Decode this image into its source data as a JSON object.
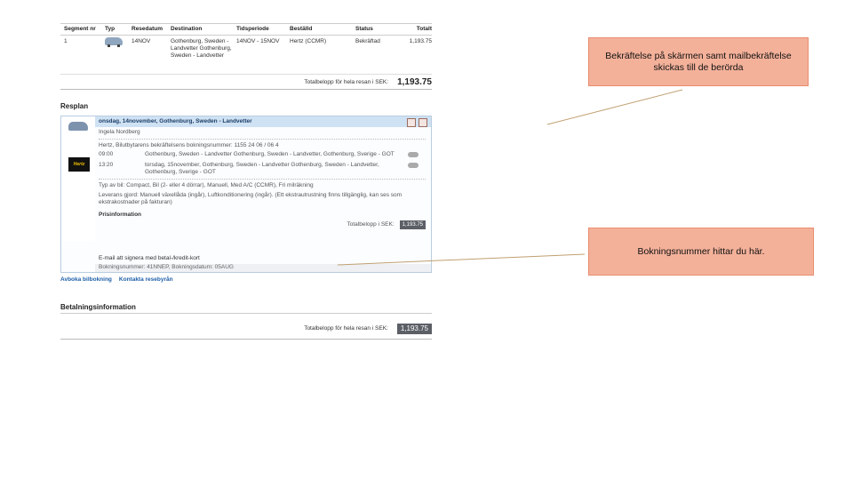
{
  "summary": {
    "headers": [
      "Segment nr",
      "Typ",
      "Resedatum",
      "Destination",
      "Tidsperiode",
      "Beställd",
      "Status",
      "Totalt"
    ],
    "row": {
      "segment": "1",
      "date": "14NOV",
      "destination": "Gothenburg, Sweden - Landvetter Gothenburg, Sweden - Landvetter",
      "period": "14NOV - 15NOV",
      "ordered": "Hertz (CCMR)",
      "status": "Bekräftad",
      "total": "1,193.75"
    },
    "total_label": "Totalbelopp för hela resan i SEK:",
    "total_amount": "1,193.75"
  },
  "itinerary": {
    "title": "Resplan",
    "header": "onsdag, 14november, Gothenburg, Sweden - Landvetter",
    "traveller": "Ingela Nordberg",
    "confirmation": "Hertz, Bilutbytarens bekräftelsens bokningsnummer: 1155 24 06 / 06 4",
    "logo": "Hertz",
    "legs": [
      {
        "time": "09:00",
        "text": "Gothenburg, Sweden - Landvetter Gothenburg, Sweden - Landvetter, Gothenburg, Sverige - GOT"
      },
      {
        "time": "13:20",
        "text": "torsdag, 15november, Gothenburg, Sweden - Landvetter Gothenburg, Sweden - Landvetter, Gothenburg, Sverige - GOT"
      }
    ],
    "car_info": "Typ av bil: Compact, Bil (2- eller 4 dörrar), Manuell, Med A/C (CCMR), Fri milräkning",
    "conditions": "Leverans gjord: Manuell växellåda (ingår), Luftkonditionering (ingår). (Ett ekstrautrustning finns tillgänglig, kan ses som ekstrakostnader på fakturan)",
    "price_heading": "Prisinformation",
    "price_label": "Totalbelopp i SEK:",
    "price_value": "1,193.75",
    "email_note": "E-mail att signera med betal-/kredit-kort",
    "booking_ref": "Bokningsnummer: 41NNEP, Bokningsdatum: 05AUG"
  },
  "links": {
    "cancel": "Avboka bilbokning",
    "contact": "Kontakta resebyrån"
  },
  "payment": {
    "title": "Betalningsinformation",
    "total_label": "Totalbelopp för hela resan i SEK:",
    "total_amount": "1,193.75"
  },
  "annotations": {
    "callout1": "Bekräftelse på skärmen samt mailbekräftelse skickas till de berörda",
    "callout2": "Bokningsnummer hittar du här."
  },
  "colors": {
    "callout_fill": "#f4b19a",
    "callout_border": "#e88c6e",
    "itinerary_header": "#cfe2f4",
    "link": "#1f5fa8"
  }
}
